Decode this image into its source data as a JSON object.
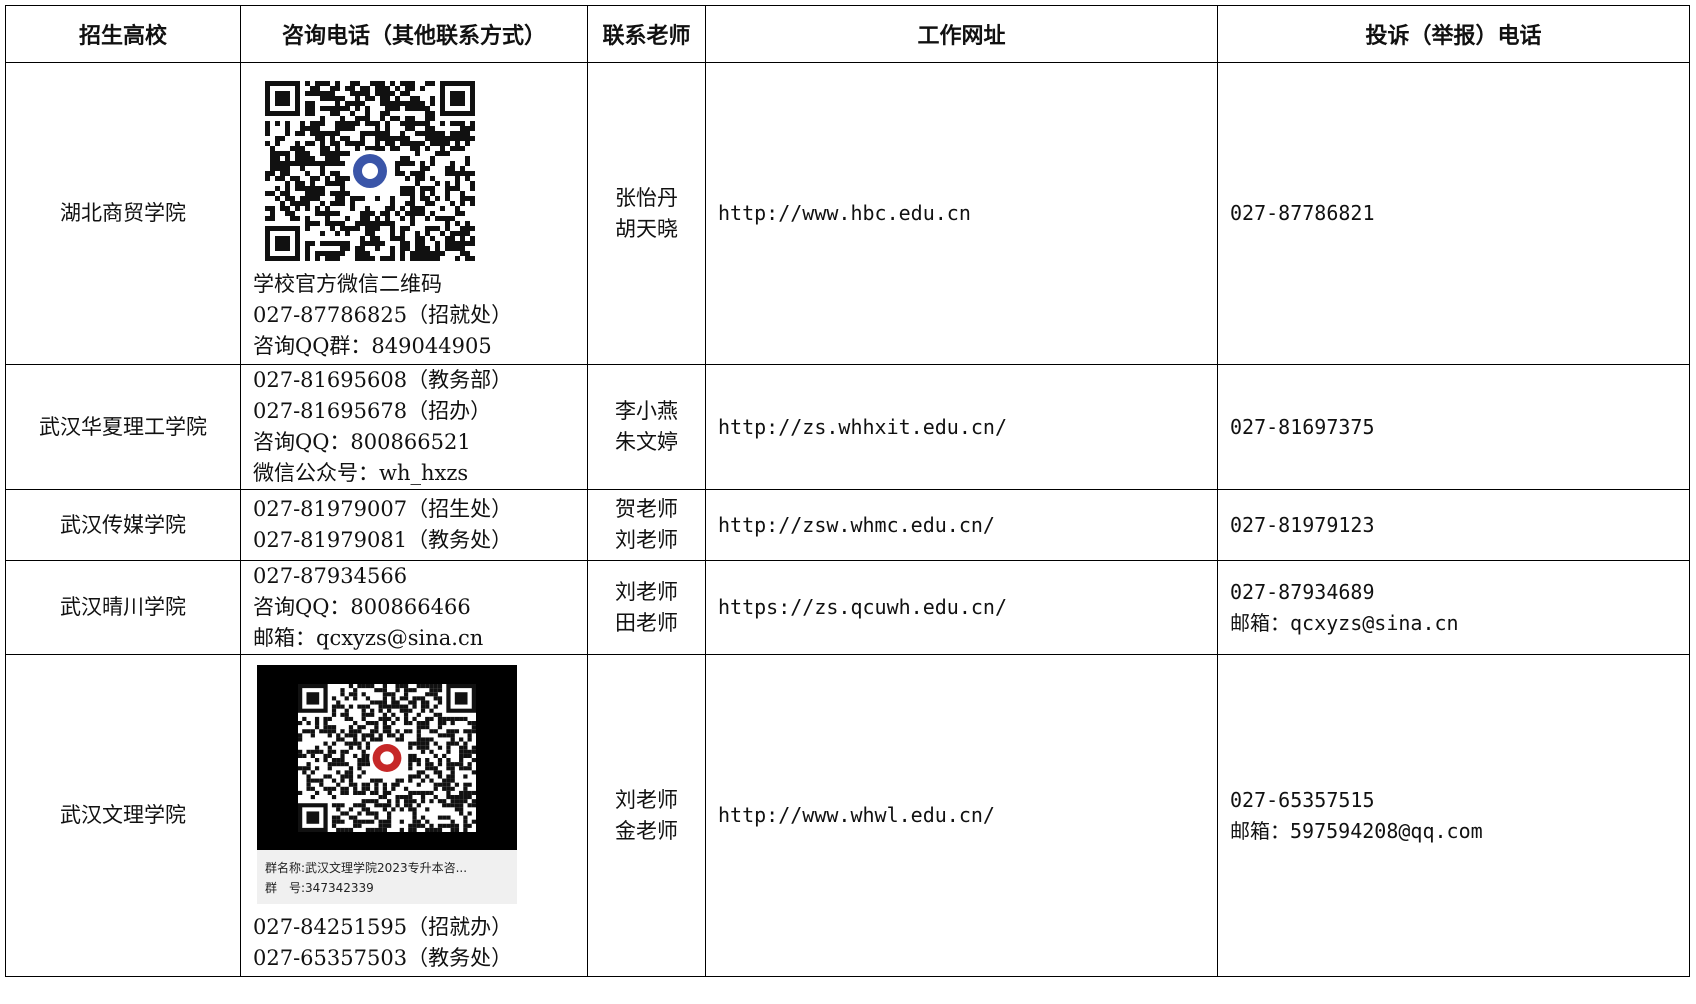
{
  "headers": [
    "招生高校",
    "咨询电话（其他联系方式）",
    "联系老师",
    "工作网址",
    "投诉（举报）电话"
  ],
  "rows": [
    {
      "school": "湖北商贸学院",
      "contact_lines": [
        "学校官方微信二维码",
        "027-87786825（招就处）",
        "咨询QQ群：849044905"
      ],
      "teachers": [
        "张怡丹",
        "胡天晓"
      ],
      "url": "http://www.hbc.edu.cn",
      "complaint_lines": [
        "027-87786821"
      ]
    },
    {
      "school": "武汉华夏理工学院",
      "contact_lines": [
        "027-81695608（教务部）",
        "027-81695678（招办）",
        "咨询QQ：800866521",
        "微信公众号：wh_hxzs"
      ],
      "teachers": [
        "李小燕",
        "朱文婷"
      ],
      "url": "http://zs.whhxit.edu.cn/",
      "complaint_lines": [
        "027-81697375"
      ]
    },
    {
      "school": "武汉传媒学院",
      "contact_lines": [
        "027-81979007（招生处）",
        "027-81979081（教务处）"
      ],
      "teachers": [
        "贺老师",
        "刘老师"
      ],
      "url": "http://zsw.whmc.edu.cn/",
      "complaint_lines": [
        "027-81979123"
      ]
    },
    {
      "school": "武汉晴川学院",
      "contact_lines": [
        "027-87934566",
        "咨询QQ：800866466",
        "邮箱：qcxyzs@sina.cn"
      ],
      "teachers": [
        "刘老师",
        "田老师"
      ],
      "url": "https://zs.qcuwh.edu.cn/",
      "complaint_lines": [
        "027-87934689",
        "邮箱：qcxyzs@sina.cn"
      ]
    },
    {
      "school": "武汉文理学院",
      "qr_caption": [
        "群名称:武汉文理学院2023专升本咨...",
        "群　号:347342339"
      ],
      "contact_lines": [
        "027-84251595（招就办）",
        "027-65357503（教务处）"
      ],
      "teachers": [
        "刘老师",
        "金老师"
      ],
      "url": "http://www.whwl.edu.cn/",
      "complaint_lines": [
        "027-65357515",
        "邮箱：597594208@qq.com"
      ]
    }
  ],
  "colors": {
    "border": "#000000",
    "text": "#111111",
    "qr_dark": "#111111",
    "logo_blue": "#3a55a8",
    "logo_red": "#c62828"
  }
}
